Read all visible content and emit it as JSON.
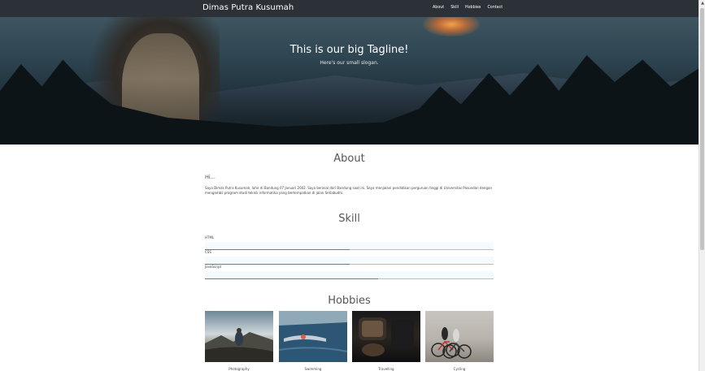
{
  "navbar": {
    "brand": "Dimas Putra Kusumah",
    "links": [
      "About",
      "Skill",
      "Hobbies",
      "Contact"
    ]
  },
  "hero": {
    "title": "This is our big Tagline!",
    "subtitle": "Here's our small slogan."
  },
  "about": {
    "heading": "About",
    "greeting": "Hi...",
    "text": "Saya Dimas Putra Kusumah, lahir di Bandung 07 Januari 2002. Saya berasal dari Bandung saat ini. Saya menjalani pendidikan perguruan tinggi di Universitas Pasundan dengan mengambil program studi teknik informatika yang bertempatkan di jalan Setiabudhi."
  },
  "skill": {
    "heading": "Skill",
    "items": [
      {
        "label": "HTML",
        "level": 0.5
      },
      {
        "label": "CSS",
        "level": 0.5
      },
      {
        "label": "JavaScript",
        "level": 0.6
      }
    ]
  },
  "hobbies": {
    "heading": "Hobbies",
    "items": [
      {
        "label": "Photography"
      },
      {
        "label": "Swimming"
      },
      {
        "label": "Travelling"
      },
      {
        "label": "Cycling"
      }
    ]
  },
  "colors": {
    "navbar": "#2b3136",
    "accent_line": "#7fd6dd",
    "skill_fill": "#6f7c85"
  }
}
